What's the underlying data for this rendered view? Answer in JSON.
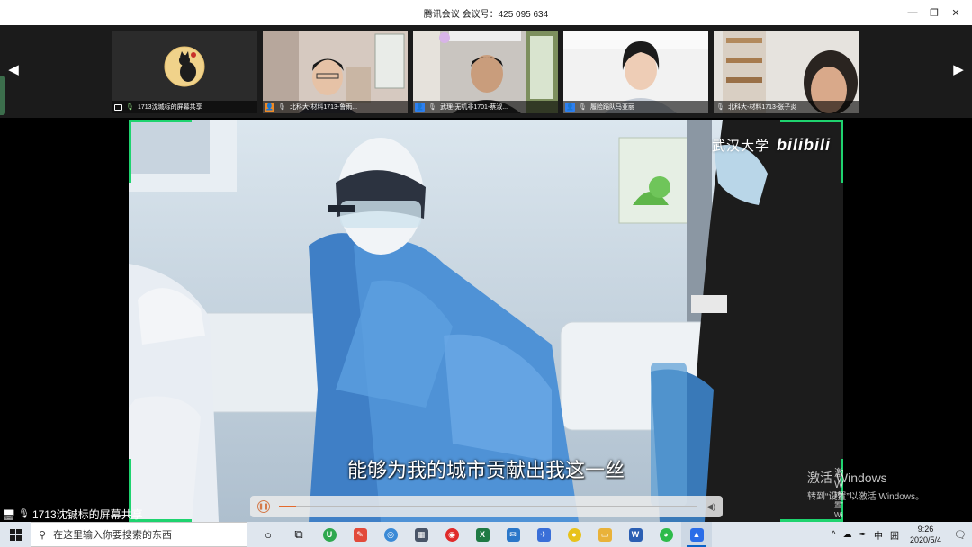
{
  "window": {
    "title": "腾讯会议 会议号：425 095 634",
    "minimize": "—",
    "restore": "❐",
    "close": "✕"
  },
  "participants_strip": {
    "prev_arrow": "◀",
    "next_arrow": "▶",
    "tiles": [
      {
        "name": "1713沈城标的屏幕共享",
        "badge": "screen"
      },
      {
        "name": "北科大-材料1713-鲁雨...",
        "badge": "avatar-orange"
      },
      {
        "name": "武理-无机非1701-蔡淑...",
        "badge": "avatar-blue"
      },
      {
        "name": "履险蹈队马亚丽",
        "badge": "avatar-blue"
      },
      {
        "name": "北科大-材料1713-张子炎",
        "badge": "none"
      }
    ]
  },
  "shared_video": {
    "brand_left": "武汉大学",
    "brand_right": "bilibili",
    "subtitle": "能够为我的城市贡献出我这一丝",
    "playback_progress": 0.04,
    "volume_glyph": "◀)"
  },
  "watermarks": {
    "small_title": "激活 Windows",
    "small_sub": "转到“设置”以激活 Windows。",
    "large_title": "激活 Windows",
    "large_sub": "转到“设置”以激活 Windows。"
  },
  "share_label": "1713沈铖标的屏幕共享",
  "taskbar": {
    "search_placeholder": "在这里输入你要搜索的东西",
    "tray_ime": "中",
    "tray_grid": "囲",
    "time": "9:26",
    "date": "2020/5/4"
  },
  "colors": {
    "frame_green": "#1fd36f",
    "progress_orange": "#e46a2c",
    "taskbar_bg": "#dfe6ee"
  }
}
